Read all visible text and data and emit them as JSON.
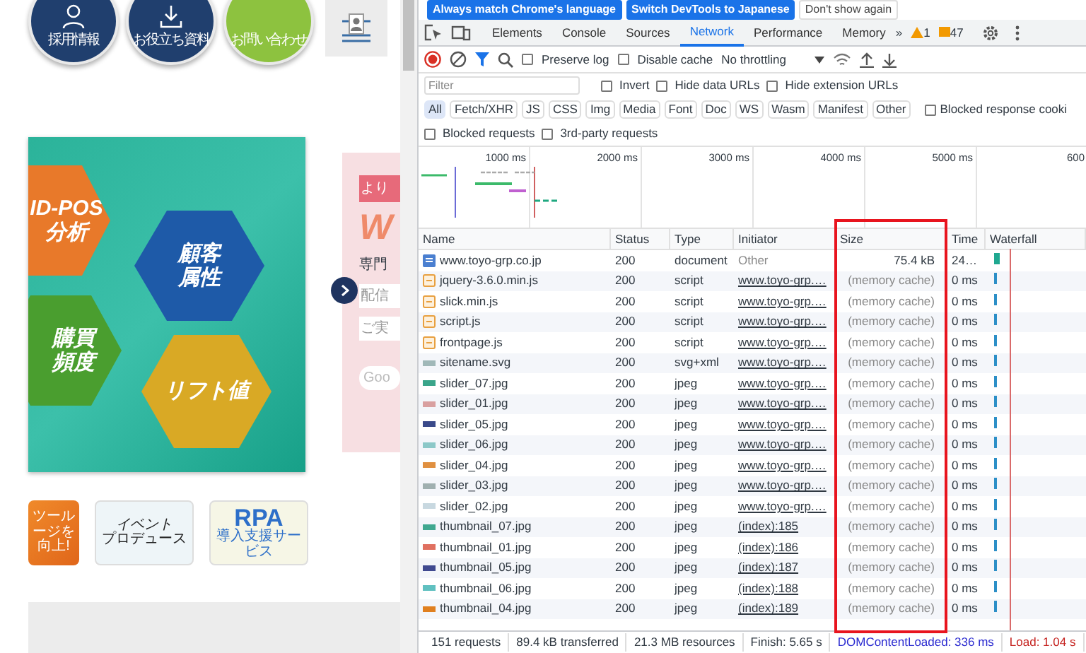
{
  "website": {
    "header_links": [
      {
        "label": "採用情報",
        "kind": "person",
        "color": "#203f6e"
      },
      {
        "label": "お役立ち資料",
        "kind": "download",
        "color": "#203f6e"
      },
      {
        "label": "お問い合わせ",
        "kind": "plain",
        "color": "#8dc23f"
      }
    ],
    "banner": {
      "hexagons": [
        {
          "lines": [
            "ID-POS",
            "分析"
          ],
          "color": "#e8792a"
        },
        {
          "lines": [
            "顧客",
            "属性"
          ],
          "color": "#1e5aa8"
        },
        {
          "lines": [
            "購買",
            "頻度"
          ],
          "color": "#4a9e2f"
        },
        {
          "lines": [
            "リフト値"
          ],
          "color": "#d9a925"
        }
      ]
    },
    "side_banner": {
      "tag": "より",
      "logo": "W",
      "lines": [
        "専門",
        "配信",
        "ご実"
      ],
      "button": "Goo"
    },
    "thumbnails": [
      {
        "kind": "tool",
        "title": "ツール",
        "subtitle": "ージを向上!"
      },
      {
        "kind": "event",
        "title": "イベント",
        "subtitle": "プロデュース"
      },
      {
        "kind": "rpa",
        "title": "RPA",
        "subtitle": "導入支援サービス"
      }
    ]
  },
  "devtools": {
    "infobar": {
      "buttons": [
        {
          "label": "Always match Chrome's language",
          "kind": "primary"
        },
        {
          "label": "Switch DevTools to Japanese",
          "kind": "primary"
        },
        {
          "label": "Don't show again",
          "kind": "plain"
        }
      ]
    },
    "tabs": [
      {
        "label": "Elements",
        "selected": false
      },
      {
        "label": "Console",
        "selected": false
      },
      {
        "label": "Sources",
        "selected": false
      },
      {
        "label": "Network",
        "selected": true
      },
      {
        "label": "Performance",
        "selected": false
      },
      {
        "label": "Memory",
        "selected": false
      }
    ],
    "more_tabs": "»",
    "warnings": "1",
    "messages": "47",
    "toolbar": {
      "recording": true,
      "options": [
        {
          "label": "Preserve log",
          "checked": false
        },
        {
          "label": "Disable cache",
          "checked": false
        }
      ],
      "throttling": "No throttling"
    },
    "filter": {
      "placeholder": "Filter",
      "options": [
        {
          "label": "Invert",
          "checked": false
        },
        {
          "label": "Hide data URLs",
          "checked": false
        },
        {
          "label": "Hide extension URLs",
          "checked": false
        }
      ]
    },
    "type_filters": [
      {
        "label": "All",
        "selected": true
      },
      {
        "label": "Fetch/XHR",
        "selected": false
      },
      {
        "label": "JS",
        "selected": false
      },
      {
        "label": "CSS",
        "selected": false
      },
      {
        "label": "Img",
        "selected": false
      },
      {
        "label": "Media",
        "selected": false
      },
      {
        "label": "Font",
        "selected": false
      },
      {
        "label": "Doc",
        "selected": false
      },
      {
        "label": "WS",
        "selected": false
      },
      {
        "label": "Wasm",
        "selected": false
      },
      {
        "label": "Manifest",
        "selected": false
      },
      {
        "label": "Other",
        "selected": false
      }
    ],
    "blocked_cookies": {
      "label": "Blocked response cooki",
      "checked": false
    },
    "extra_options": [
      {
        "label": "Blocked requests",
        "checked": false
      },
      {
        "label": "3rd-party requests",
        "checked": false
      }
    ],
    "overview": {
      "ticks": [
        "1000 ms",
        "2000 ms",
        "3000 ms",
        "4000 ms",
        "5000 ms",
        "600"
      ]
    },
    "table": {
      "columns": [
        {
          "label": "Name",
          "highlighted": false
        },
        {
          "label": "Status",
          "highlighted": false
        },
        {
          "label": "Type",
          "highlighted": false
        },
        {
          "label": "Initiator",
          "highlighted": false
        },
        {
          "label": "Size",
          "highlighted": true
        },
        {
          "label": "Time",
          "highlighted": false
        },
        {
          "label": "Waterfall",
          "highlighted": false
        }
      ],
      "rows": [
        {
          "name": "www.toyo-grp.co.jp",
          "status": "200",
          "type": "document",
          "initiator": "Other",
          "initiator_link": false,
          "size": "75.4 kB",
          "from_cache": false,
          "time": "24…",
          "kind": "document",
          "color": "#4a7fd0"
        },
        {
          "name": "jquery-3.6.0.min.js",
          "status": "200",
          "type": "script",
          "initiator": "www.toyo-grp.…",
          "initiator_link": true,
          "size": "(memory cache)",
          "from_cache": true,
          "time": "0 ms",
          "kind": "script",
          "color": "#e8a040"
        },
        {
          "name": "slick.min.js",
          "status": "200",
          "type": "script",
          "initiator": "www.toyo-grp.…",
          "initiator_link": true,
          "size": "(memory cache)",
          "from_cache": true,
          "time": "0 ms",
          "kind": "script",
          "color": "#e8a040"
        },
        {
          "name": "script.js",
          "status": "200",
          "type": "script",
          "initiator": "www.toyo-grp.…",
          "initiator_link": true,
          "size": "(memory cache)",
          "from_cache": true,
          "time": "0 ms",
          "kind": "script",
          "color": "#e8a040"
        },
        {
          "name": "frontpage.js",
          "status": "200",
          "type": "script",
          "initiator": "www.toyo-grp.…",
          "initiator_link": true,
          "size": "(memory cache)",
          "from_cache": true,
          "time": "0 ms",
          "kind": "script",
          "color": "#e8a040"
        },
        {
          "name": "sitename.svg",
          "status": "200",
          "type": "svg+xml",
          "initiator": "www.toyo-grp.…",
          "initiator_link": true,
          "size": "(memory cache)",
          "from_cache": true,
          "time": "0 ms",
          "kind": "image",
          "color": "#a0b8b8"
        },
        {
          "name": "slider_07.jpg",
          "status": "200",
          "type": "jpeg",
          "initiator": "www.toyo-grp.…",
          "initiator_link": true,
          "size": "(memory cache)",
          "from_cache": true,
          "time": "0 ms",
          "kind": "image",
          "color": "#3aa58a"
        },
        {
          "name": "slider_01.jpg",
          "status": "200",
          "type": "jpeg",
          "initiator": "www.toyo-grp.…",
          "initiator_link": true,
          "size": "(memory cache)",
          "from_cache": true,
          "time": "0 ms",
          "kind": "image",
          "color": "#d9a0a0"
        },
        {
          "name": "slider_05.jpg",
          "status": "200",
          "type": "jpeg",
          "initiator": "www.toyo-grp.…",
          "initiator_link": true,
          "size": "(memory cache)",
          "from_cache": true,
          "time": "0 ms",
          "kind": "image",
          "color": "#3a4a8a"
        },
        {
          "name": "slider_06.jpg",
          "status": "200",
          "type": "jpeg",
          "initiator": "www.toyo-grp.…",
          "initiator_link": true,
          "size": "(memory cache)",
          "from_cache": true,
          "time": "0 ms",
          "kind": "image",
          "color": "#8cc8c8"
        },
        {
          "name": "slider_04.jpg",
          "status": "200",
          "type": "jpeg",
          "initiator": "www.toyo-grp.…",
          "initiator_link": true,
          "size": "(memory cache)",
          "from_cache": true,
          "time": "0 ms",
          "kind": "image",
          "color": "#e09040"
        },
        {
          "name": "slider_03.jpg",
          "status": "200",
          "type": "jpeg",
          "initiator": "www.toyo-grp.…",
          "initiator_link": true,
          "size": "(memory cache)",
          "from_cache": true,
          "time": "0 ms",
          "kind": "image",
          "color": "#a0b0b0"
        },
        {
          "name": "slider_02.jpg",
          "status": "200",
          "type": "jpeg",
          "initiator": "www.toyo-grp.…",
          "initiator_link": true,
          "size": "(memory cache)",
          "from_cache": true,
          "time": "0 ms",
          "kind": "image",
          "color": "#c8d8e0"
        },
        {
          "name": "thumbnail_07.jpg",
          "status": "200",
          "type": "jpeg",
          "initiator": "(index):185",
          "initiator_link": true,
          "size": "(memory cache)",
          "from_cache": true,
          "time": "0 ms",
          "kind": "image",
          "color": "#40a890"
        },
        {
          "name": "thumbnail_01.jpg",
          "status": "200",
          "type": "jpeg",
          "initiator": "(index):186",
          "initiator_link": true,
          "size": "(memory cache)",
          "from_cache": true,
          "time": "0 ms",
          "kind": "image",
          "color": "#e07060"
        },
        {
          "name": "thumbnail_05.jpg",
          "status": "200",
          "type": "jpeg",
          "initiator": "(index):187",
          "initiator_link": true,
          "size": "(memory cache)",
          "from_cache": true,
          "time": "0 ms",
          "kind": "image",
          "color": "#404a90"
        },
        {
          "name": "thumbnail_06.jpg",
          "status": "200",
          "type": "jpeg",
          "initiator": "(index):188",
          "initiator_link": true,
          "size": "(memory cache)",
          "from_cache": true,
          "time": "0 ms",
          "kind": "image",
          "color": "#60c0c0"
        },
        {
          "name": "thumbnail_04.jpg",
          "status": "200",
          "type": "jpeg",
          "initiator": "(index):189",
          "initiator_link": true,
          "size": "(memory cache)",
          "from_cache": true,
          "time": "0 ms",
          "kind": "image",
          "color": "#e08020"
        }
      ]
    },
    "status_bar": [
      {
        "text": "151 requests",
        "kind": "plain"
      },
      {
        "text": "89.4 kB transferred",
        "kind": "plain"
      },
      {
        "text": "21.3 MB resources",
        "kind": "plain"
      },
      {
        "text": "Finish: 5.65 s",
        "kind": "plain"
      },
      {
        "text": "DOMContentLoaded: 336 ms",
        "kind": "dom"
      },
      {
        "text": "Load: 1.04 s",
        "kind": "load"
      }
    ]
  }
}
